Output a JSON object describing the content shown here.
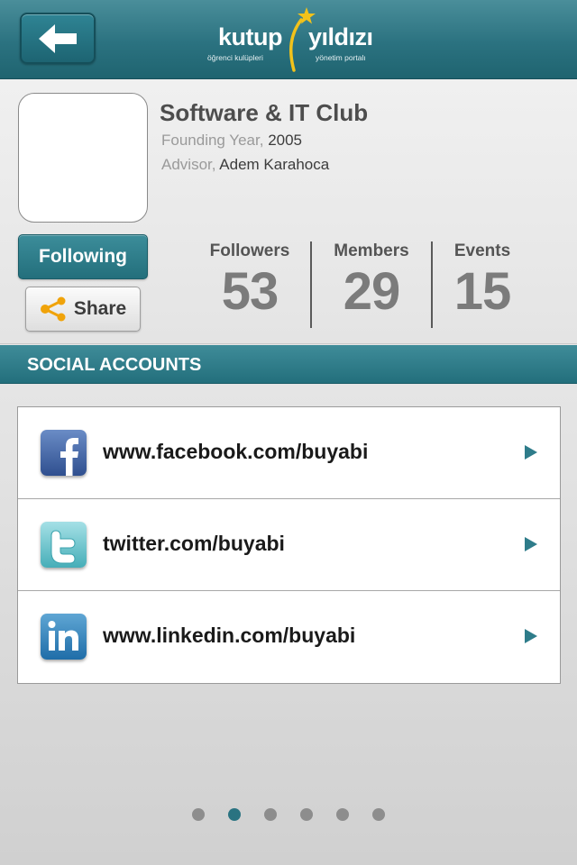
{
  "header": {
    "back_icon": "back-arrow-icon",
    "logo": {
      "word_left": "kutup",
      "word_right": "yıldızı",
      "sub_left": "öğrenci kulüpleri",
      "sub_right": "yönetim portalı"
    }
  },
  "profile": {
    "club_name": "Software & IT Club",
    "founding_label": "Founding Year,",
    "founding_value": "2005",
    "advisor_label": "Advisor,",
    "advisor_value": "Adem Karahoca",
    "follow_label": "Following",
    "share_label": "Share",
    "stats": [
      {
        "label": "Followers",
        "value": "53"
      },
      {
        "label": "Members",
        "value": "29"
      },
      {
        "label": "Events",
        "value": "15"
      }
    ]
  },
  "social": {
    "title": "SOCIAL ACCOUNTS",
    "items": [
      {
        "icon": "facebook-icon",
        "label": "www.facebook.com/buyabi"
      },
      {
        "icon": "twitter-icon",
        "label": "twitter.com/buyabi"
      },
      {
        "icon": "linkedin-icon",
        "label": "www.linkedin.com/buyabi"
      }
    ]
  },
  "pager": {
    "total": 6,
    "active_index": 1
  },
  "colors": {
    "accent": "#2b7280",
    "dot_active": "#2a7381",
    "dot_inactive": "#8d8d8d"
  }
}
